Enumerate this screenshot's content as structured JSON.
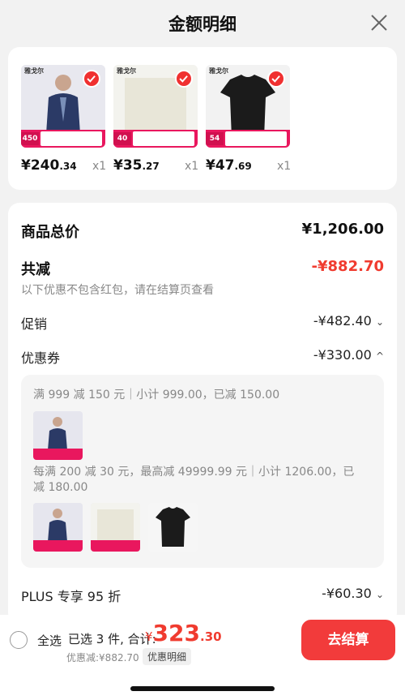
{
  "header": {
    "title": "金额明细"
  },
  "products": [
    {
      "name": "jacket",
      "price_int": "¥240",
      "price_dec": ".34",
      "qty": "x1",
      "banner": "450",
      "logo": "雅戈尔"
    },
    {
      "name": "square-cloth",
      "price_int": "¥35",
      "price_dec": ".27",
      "qty": "x1",
      "banner": "40",
      "logo": "雅戈尔"
    },
    {
      "name": "black-tshirt",
      "price_int": "¥47",
      "price_dec": ".69",
      "qty": "x1",
      "banner": "54",
      "logo": "雅戈尔"
    }
  ],
  "summary": {
    "total_label": "商品总价",
    "total_value": "¥1,206.00",
    "reduce_label": "共减",
    "reduce_value": "-¥882.70",
    "note": "以下优惠不包含红包，请在结算页查看",
    "promo_label": "促销",
    "promo_value": "-¥482.40",
    "coupon_label": "优惠券",
    "coupon_value": "-¥330.00",
    "coupon1": "满 999 减 150 元｜小计 999.00，已减 150.00",
    "coupon2_line1": "每满 200 减 30 元，最高减 49999.99 元｜小计 1206.00，已",
    "coupon2_line2": "减 180.00",
    "plus_label": "PLUS 专享 95 折",
    "plus_value": "-¥60.30"
  },
  "bottom": {
    "select_all": "全选",
    "selected": "已选 3 件, 合计:",
    "sum_currency": "¥",
    "sum_int": "323",
    "sum_dec": ".30",
    "discount": "优惠减:¥882.70",
    "detail_link": "优惠明细",
    "checkout": "去结算"
  },
  "colors": {
    "accent": "#f03b2f",
    "button": "#f23b3b",
    "banner": "#e9175e"
  }
}
